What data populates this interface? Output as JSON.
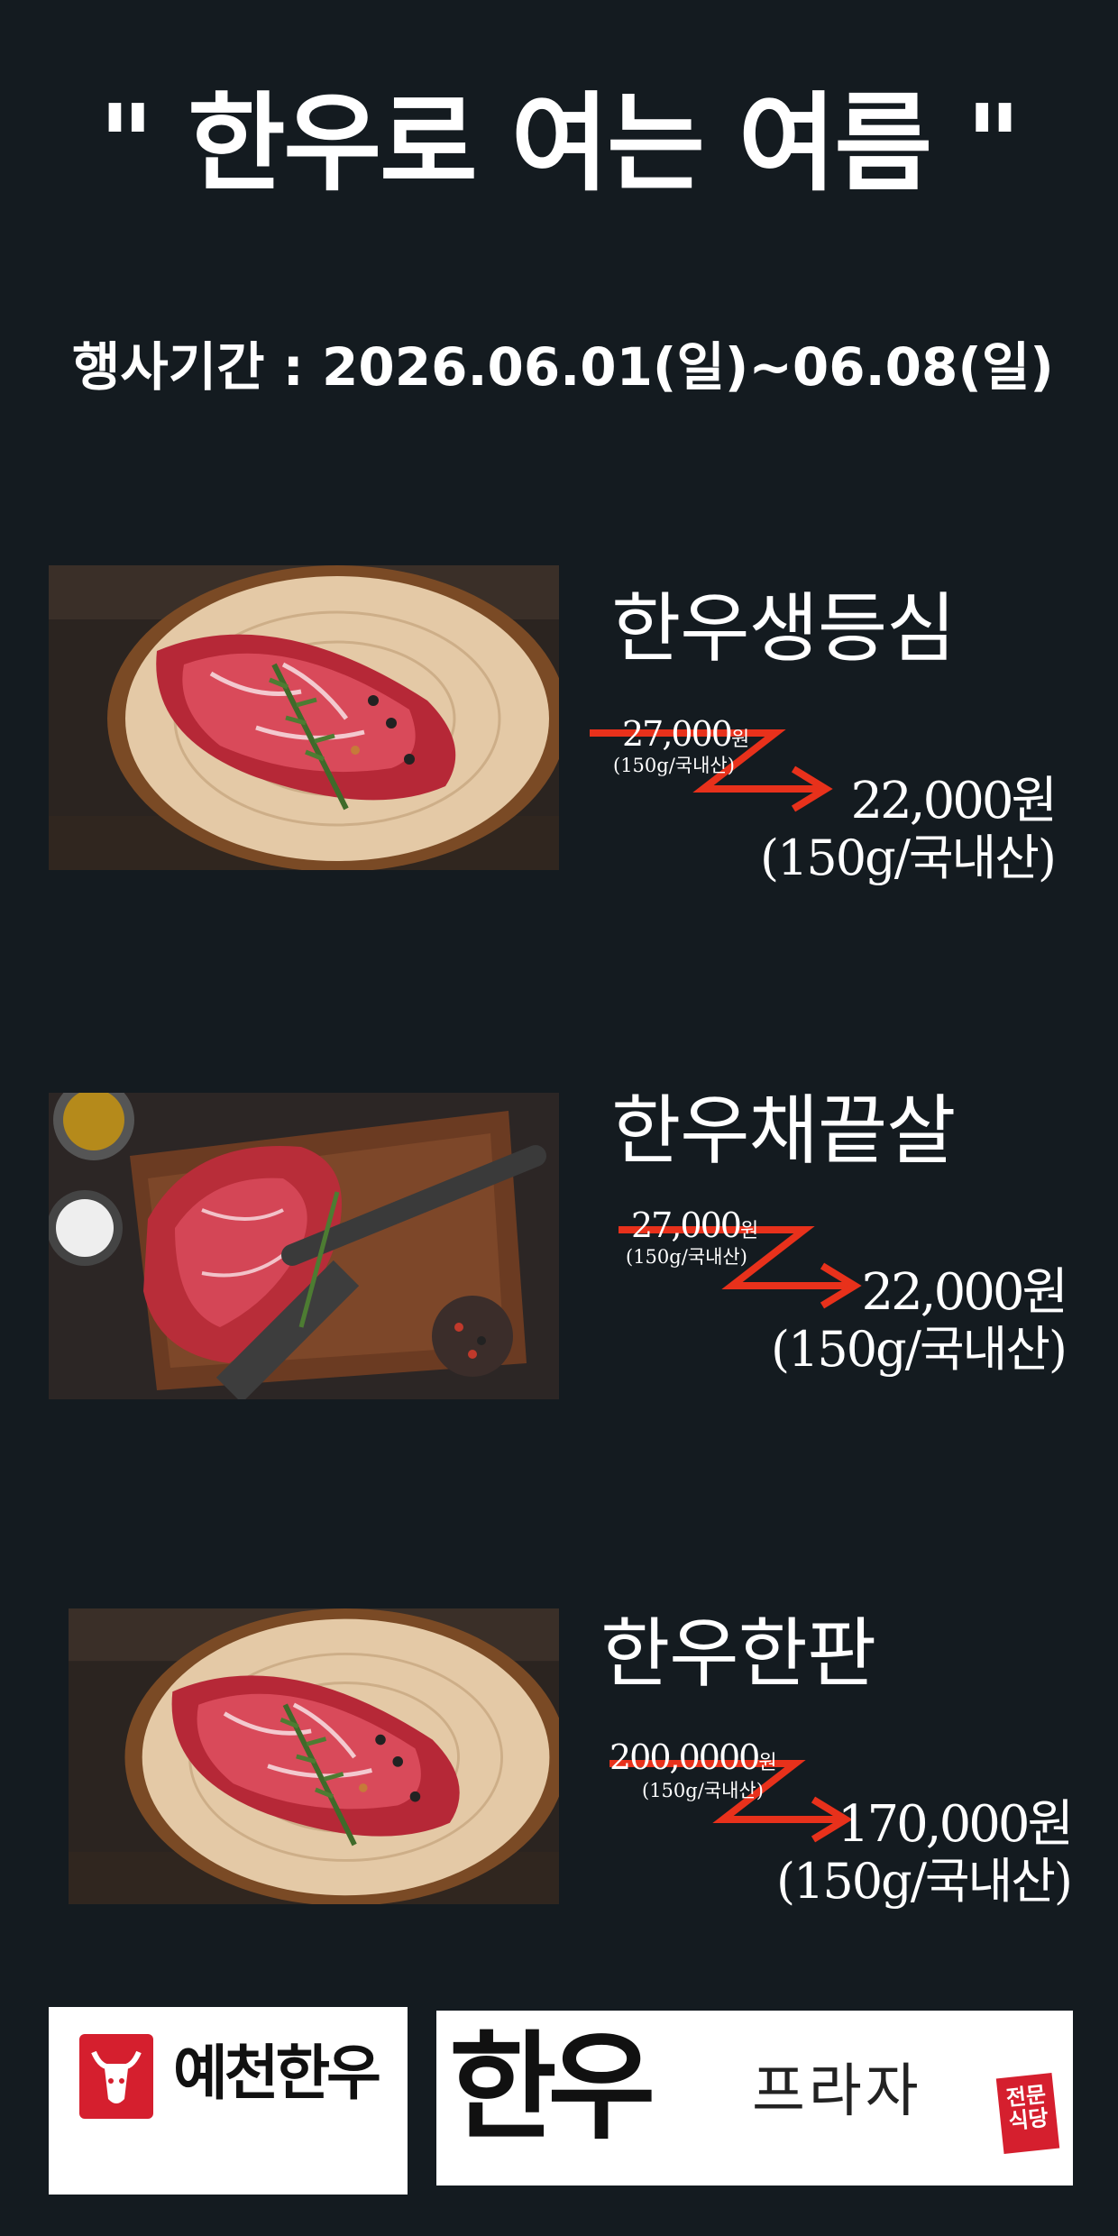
{
  "header": {
    "title": "\" 한우로 여는 여름 \"",
    "period": "행사기간 : 2026.06.01(일)~06.08(일)"
  },
  "products": [
    {
      "name": "한우생등심",
      "old_price": "27,000",
      "old_currency": "원",
      "old_unit": "(150g/국내산)",
      "new_price": "22,000원",
      "new_unit": "(150g/국내산)",
      "photo": "steak-on-wood-board-photo"
    },
    {
      "name": "한우채끝살",
      "old_price": "27,000",
      "old_currency": "원",
      "old_unit": "(150g/국내산)",
      "new_price": "22,000원",
      "new_unit": "(150g/국내산)",
      "photo": "steak-on-cutting-board-with-knife-photo"
    },
    {
      "name": "한우한판",
      "old_price": "200,0000",
      "old_currency": "원",
      "old_unit": "(150g/국내산)",
      "new_price": "170,000원",
      "new_unit": "(150g/국내산)",
      "photo": "steak-on-wood-board-photo"
    }
  ],
  "logos": {
    "left_text": "예천한우",
    "right_brush": "한우",
    "right_text": "프라자",
    "stamp": "전문식당"
  },
  "colors": {
    "background": "#141b20",
    "accent_red": "#e8311b",
    "text": "#ffffff"
  }
}
